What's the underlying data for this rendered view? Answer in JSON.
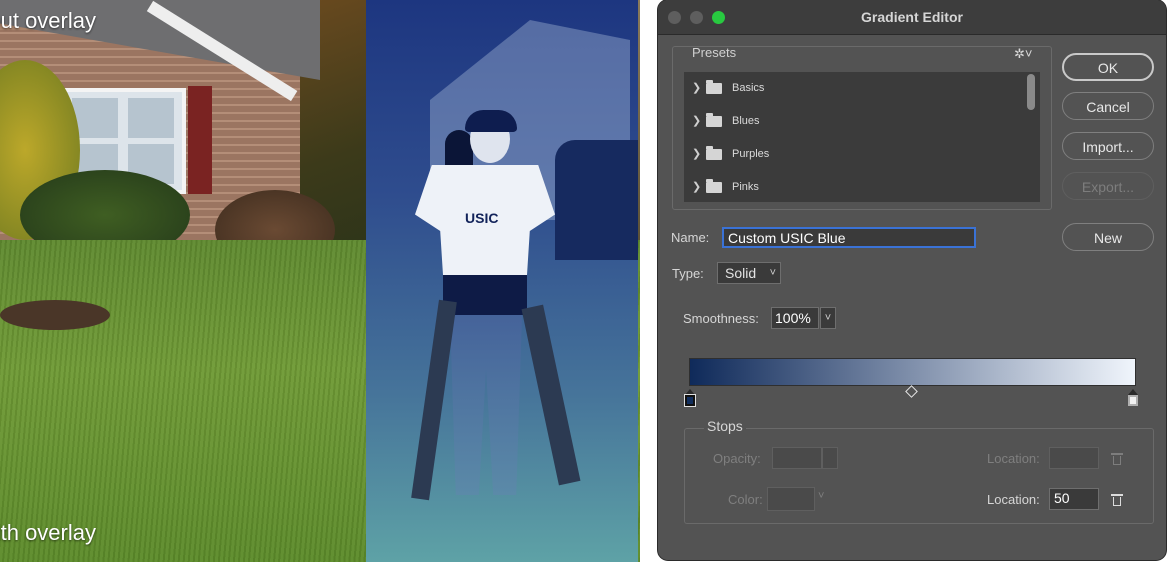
{
  "image": {
    "caption_top": "Without overlay",
    "caption_bottom": "With overlay",
    "shirt_logo": "USIC"
  },
  "window": {
    "title": "Gradient Editor",
    "traffic_lights": [
      "close",
      "minimize",
      "zoom"
    ]
  },
  "presets": {
    "label": "Presets",
    "settings_icon": "gear-icon",
    "items": [
      {
        "label": "Basics"
      },
      {
        "label": "Blues"
      },
      {
        "label": "Purples"
      },
      {
        "label": "Pinks"
      }
    ]
  },
  "buttons": {
    "ok": "OK",
    "cancel": "Cancel",
    "import": "Import...",
    "export": "Export...",
    "new": "New"
  },
  "form": {
    "name_label": "Name:",
    "name_value": "Custom USIC Blue",
    "type_label": "Type:",
    "type_value": "Solid",
    "smoothness_label": "Smoothness:",
    "smoothness_value": "100%"
  },
  "gradient": {
    "start_color": "#0f2a5a",
    "end_color": "#f0f5fc",
    "midpoint_percent": 50
  },
  "stops": {
    "label": "Stops",
    "opacity_label": "Opacity:",
    "opacity_location_label": "Location:",
    "color_label": "Color:",
    "color_location_label": "Location:",
    "color_location_value": "50"
  },
  "colors": {
    "window_bg": "#535353",
    "title_bar": "#3d3d3d",
    "focus_ring": "#3a72d6",
    "zoom_light": "#28c940"
  }
}
